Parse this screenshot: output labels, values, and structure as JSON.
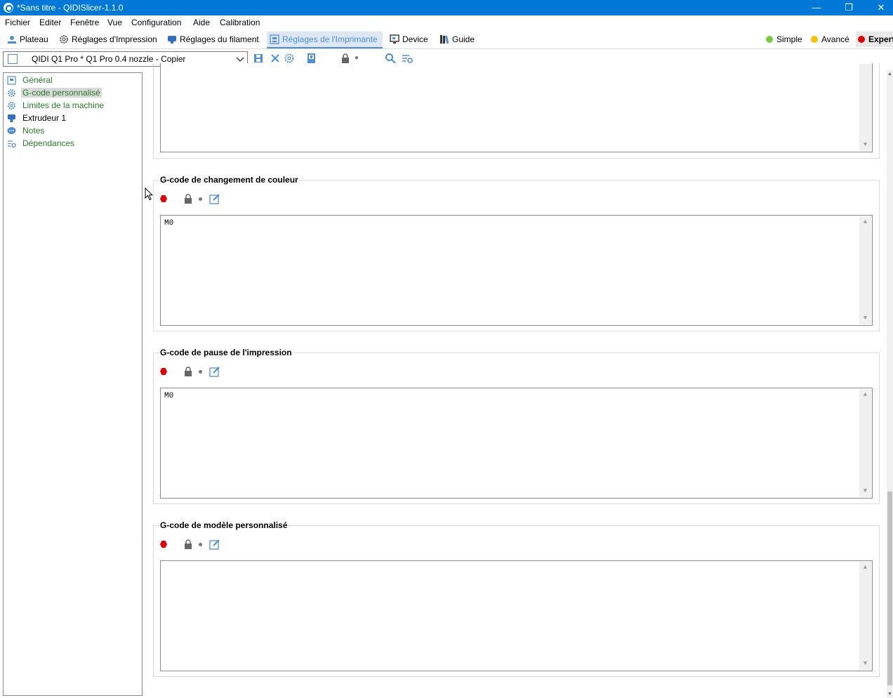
{
  "window": {
    "title": "*Sans titre - QIDISlicer-1.1.0",
    "minimize": "—",
    "restore": "❐",
    "close": "✕"
  },
  "menu": [
    "Fichier",
    "Editer",
    "Fenêtre",
    "Vue",
    "Configuration",
    "Aide",
    "Calibration"
  ],
  "tabs": [
    {
      "label": "Plateau",
      "icon": "plater-icon"
    },
    {
      "label": "Réglages d'Impression",
      "icon": "gear-icon"
    },
    {
      "label": "Réglages du filament",
      "icon": "filament-icon"
    },
    {
      "label": "Réglages de l'Imprimante",
      "icon": "printer-icon",
      "active": true
    },
    {
      "label": "Device",
      "icon": "monitor-icon"
    },
    {
      "label": "Guide",
      "icon": "books-icon"
    }
  ],
  "modes": [
    {
      "label": "Simple",
      "color": "#7ac943"
    },
    {
      "label": "Avancé",
      "color": "#f2c200"
    },
    {
      "label": "Expert",
      "color": "#e00000"
    }
  ],
  "preset": {
    "value": "QIDI Q1 Pro * Q1 Pro 0.4 nozzle - Copier"
  },
  "tree": [
    {
      "label": "Général",
      "icon": "printer-page-icon"
    },
    {
      "label": "G-code personnalisé",
      "icon": "gear-icon",
      "selected": true
    },
    {
      "label": "Limites de la machine",
      "icon": "gear-icon"
    },
    {
      "label": "Extrudeur 1",
      "icon": "extruder-icon"
    },
    {
      "label": "Notes",
      "icon": "notes-icon"
    },
    {
      "label": "Dépendances",
      "icon": "dependencies-icon"
    }
  ],
  "groups": [
    {
      "title": "G-code de changement de couleur",
      "code": "M0"
    },
    {
      "title": "G-code de pause de l'impression",
      "code": "M0"
    },
    {
      "title": "G-code de modèle personnalisé",
      "code": ""
    }
  ]
}
